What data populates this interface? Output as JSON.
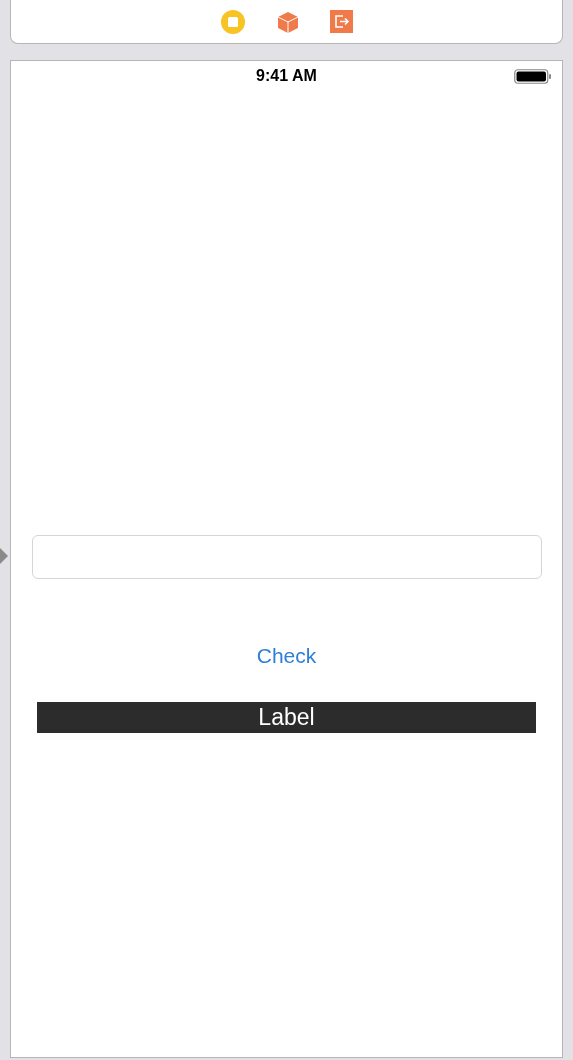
{
  "status_bar": {
    "time": "9:41 AM"
  },
  "button": {
    "label": "Check"
  },
  "label": {
    "text": "Label"
  }
}
